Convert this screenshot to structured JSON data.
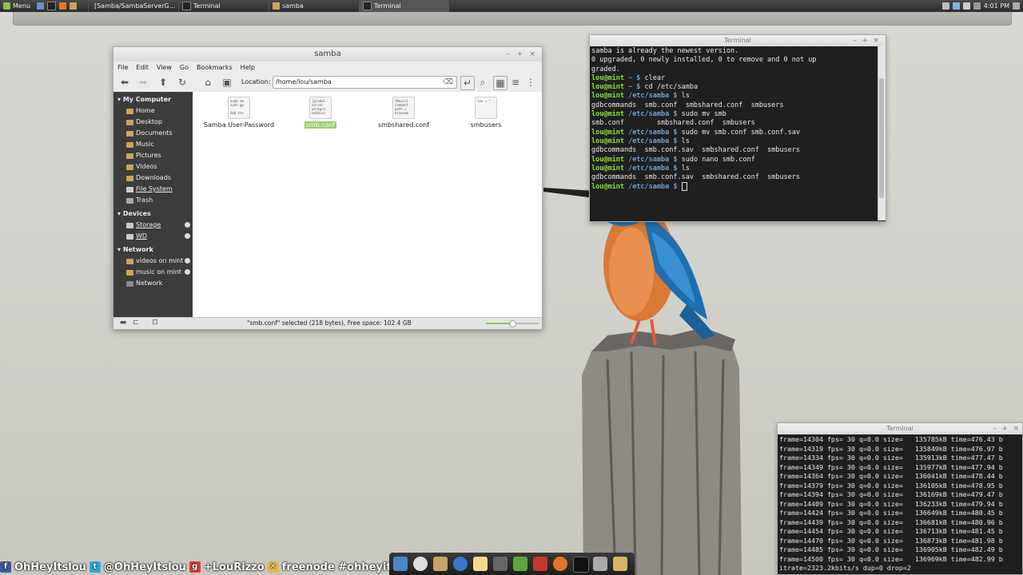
{
  "top_panel": {
    "menu_label": "Menu",
    "tasks": [
      {
        "label": "[Samba/SambaServerG..."
      },
      {
        "label": "Terminal"
      },
      {
        "label": "samba"
      },
      {
        "label": "Terminal"
      }
    ],
    "clock": "4:01 PM"
  },
  "file_manager": {
    "title": "samba",
    "menu": [
      "File",
      "Edit",
      "View",
      "Go",
      "Bookmarks",
      "Help"
    ],
    "location_label": "Location:",
    "location_value": "/home/lou/samba",
    "sidebar": {
      "my_computer": {
        "header": "My Computer",
        "items": [
          "Home",
          "Desktop",
          "Documents",
          "Music",
          "Pictures",
          "Videos",
          "Downloads",
          "File System",
          "Trash"
        ]
      },
      "devices": {
        "header": "Devices",
        "items": [
          "Storage",
          "WD"
        ]
      },
      "network": {
        "header": "Network",
        "items": [
          "videos on mint",
          "music on mint",
          "Network"
        ]
      }
    },
    "files": [
      {
        "name": "Samba User-Password",
        "preview": "sudo sm\nsudo gp\n\nAdd the"
      },
      {
        "name": "smb.conf",
        "preview": "[global\nserver\nworkgro\nnetbios"
      },
      {
        "name": "smbshared.conf",
        "preview": "[Music]\ncomment\npath =\nbrowsab"
      },
      {
        "name": "smbusers",
        "preview": "lou = \""
      }
    ],
    "status": "\"smb.conf\" selected (218 bytes), Free space: 102.4 GB",
    "zoom_fraction": 0.5
  },
  "terminal1": {
    "title": "Terminal",
    "lines": [
      {
        "text": "samba is already the newest version."
      },
      {
        "text": "0 upgraded, 0 newly installed, 0 to remove and 0 not up"
      },
      {
        "text": "graded."
      },
      {
        "user": "lou@mint",
        "path": "~ $",
        "text": " clear"
      },
      {
        "user": "lou@mint",
        "path": "~ $",
        "text": " cd /etc/samba"
      },
      {
        "user": "lou@mint",
        "path": "/etc/samba $",
        "text": " ls"
      },
      {
        "text": "gdbcommands  smb.conf  smbshared.conf  smbusers"
      },
      {
        "user": "lou@mint",
        "path": "/etc/samba $",
        "text": " sudo mv smb"
      },
      {
        "text": "smb.conf        smbshared.conf  smbusers"
      },
      {
        "user": "lou@mint",
        "path": "/etc/samba $",
        "text": " sudo mv smb.conf smb.conf.sav"
      },
      {
        "user": "lou@mint",
        "path": "/etc/samba $",
        "text": " ls"
      },
      {
        "text": "gdbcommands  smb.conf.sav  smbshared.conf  smbusers"
      },
      {
        "user": "lou@mint",
        "path": "/etc/samba $",
        "text": " sudo nano smb.conf"
      },
      {
        "user": "lou@mint",
        "path": "/etc/samba $",
        "text": " ls"
      },
      {
        "text": "gdbcommands  smb.conf.sav  smbshared.conf  smbusers"
      },
      {
        "user": "lou@mint",
        "path": "/etc/samba $",
        "text": " ",
        "cursor": true
      }
    ]
  },
  "terminal2": {
    "title": "Terminal",
    "lines": [
      "frame=14304 fps= 30 q=0.0 size=   135785kB time=476.43 b",
      "frame=14319 fps= 30 q=0.0 size=   135849kB time=476.97 b",
      "frame=14334 fps= 30 q=0.0 size=   135913kB time=477.47 b",
      "frame=14349 fps= 30 q=0.0 size=   135977kB time=477.94 b",
      "frame=14364 fps= 30 q=0.0 size=   136041kB time=478.44 b",
      "frame=14379 fps= 30 q=0.0 size=   136105kB time=478.95 b",
      "frame=14394 fps= 30 q=0.0 size=   136169kB time=479.47 b",
      "frame=14409 fps= 30 q=0.0 size=   136233kB time=479.94 b",
      "frame=14424 fps= 30 q=0.0 size=   136649kB time=480.45 b",
      "frame=14439 fps= 30 q=0.0 size=   136681kB time=480.96 b",
      "frame=14454 fps= 30 q=0.0 size=   136713kB time=481.45 b",
      "frame=14470 fps= 30 q=0.0 size=   136873kB time=481.98 b",
      "frame=14485 fps= 30 q=0.0 size=   136905kB time=482.49 b",
      "frame=14500 fps= 30 q=0.0 size=   136969kB time=482.99 b",
      "itrate=2323.2kbits/s dup=0 drop=2"
    ]
  },
  "social": {
    "facebook": "OhHeyItslou",
    "twitter": "@OhHeyItslou",
    "googleplus": "+LouRizzo",
    "irc": "freenode #ohheyitslou"
  },
  "colors": {
    "accent_green": "#8ae234",
    "prompt_blue": "#729fcf",
    "selection_green": "#9bcf6e",
    "sidebar_bg": "#3c3c3c"
  }
}
